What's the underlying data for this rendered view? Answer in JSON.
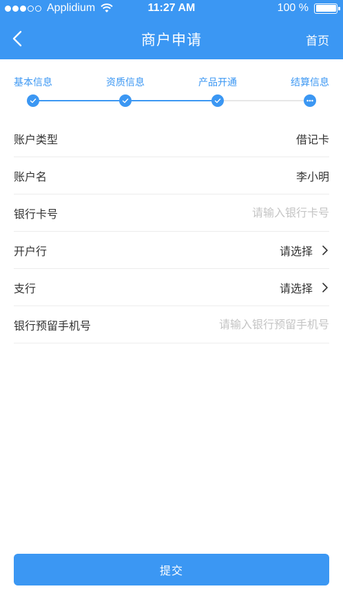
{
  "status_bar": {
    "carrier": "Applidium",
    "time": "11:27 AM",
    "battery": "100 %"
  },
  "nav": {
    "title": "商户申请",
    "home_label": "首页",
    "back_icon": "chevron-left-icon"
  },
  "steps": [
    {
      "label": "基本信息",
      "state": "done"
    },
    {
      "label": "资质信息",
      "state": "done"
    },
    {
      "label": "产品开通",
      "state": "done"
    },
    {
      "label": "结算信息",
      "state": "current"
    }
  ],
  "form": {
    "account_type": {
      "label": "账户类型",
      "value": "借记卡"
    },
    "account_name": {
      "label": "账户名",
      "value": "李小明"
    },
    "card_number": {
      "label": "银行卡号",
      "placeholder": "请输入银行卡号"
    },
    "bank": {
      "label": "开户行",
      "value": "请选择"
    },
    "branch": {
      "label": "支行",
      "value": "请选择"
    },
    "phone": {
      "label": "银行预留手机号",
      "placeholder": "请输入银行预留手机号"
    }
  },
  "submit_label": "提交",
  "colors": {
    "primary": "#3b97f3",
    "divider": "#ececec",
    "placeholder": "#c4c4c4",
    "text": "#333333"
  }
}
